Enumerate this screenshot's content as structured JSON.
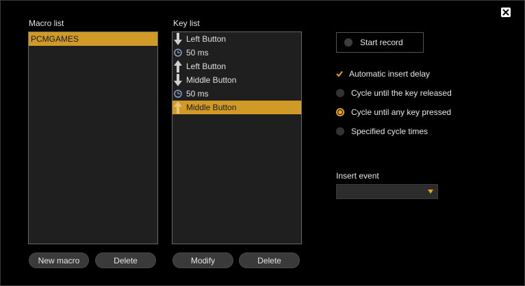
{
  "macro_list": {
    "label": "Macro list",
    "items": [
      {
        "label": "PCMGAMES",
        "selected": true
      }
    ],
    "new_button": "New macro",
    "delete_button": "Delete"
  },
  "key_list": {
    "label": "Key list",
    "items": [
      {
        "icon": "arrow-down-icon",
        "label": "Left Button",
        "selected": false
      },
      {
        "icon": "clock-icon",
        "label": "50 ms",
        "selected": false
      },
      {
        "icon": "arrow-up-icon",
        "label": "Left Button",
        "selected": false
      },
      {
        "icon": "arrow-down-icon",
        "label": "Middle Button",
        "selected": false
      },
      {
        "icon": "clock-icon",
        "label": "50 ms",
        "selected": false
      },
      {
        "icon": "arrow-up-icon",
        "label": "Middle Button",
        "selected": true
      }
    ],
    "modify_button": "Modify",
    "delete_button": "Delete"
  },
  "record": {
    "label": "Start record"
  },
  "options": {
    "auto_delay": {
      "label": "Automatic insert delay",
      "checked": true
    },
    "cycle_until_released": {
      "label": "Cycle until the key released",
      "selected": false
    },
    "cycle_until_any": {
      "label": "Cycle until any key pressed",
      "selected": true
    },
    "specified_cycle": {
      "label": "Specified cycle times",
      "selected": false
    }
  },
  "insert_event": {
    "label": "Insert event",
    "value": ""
  },
  "colors": {
    "accent": "#e8a521",
    "selection": "#d09a26",
    "panel": "#1f1f1f"
  }
}
